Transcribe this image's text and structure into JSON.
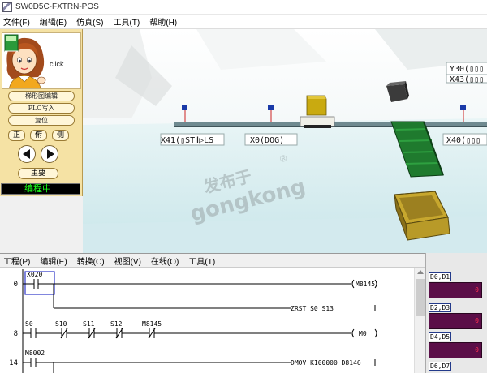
{
  "window": {
    "title": "SW0D5C-FXTRN-POS"
  },
  "menubar": [
    "文件(F)",
    "编辑(E)",
    "仿真(S)",
    "工具(T)",
    "帮助(H)"
  ],
  "sim_panel": {
    "click_label": "click",
    "buttons": {
      "ladder_edit": "梯形图编辑",
      "plc_write": "PLC写入",
      "reset": "复位",
      "main": "主要"
    },
    "view_buttons": [
      "正",
      "俯",
      "侧"
    ],
    "status": "编程中"
  },
  "scene": {
    "labels": {
      "y30": "Y30(▯▯▯",
      "x43": "X43(▯▯▯",
      "x41": "X41(▯STⅡ▷LS",
      "x0": "X0(DOG)",
      "x40": "X40(▯▯▯"
    },
    "watermark": {
      "line1": "发布于",
      "line2": "gongkong",
      "mark": "®"
    }
  },
  "editor": {
    "menu": [
      "工程(P)",
      "编辑(E)",
      "转换(C)",
      "视图(V)",
      "在线(O)",
      "工具(T)"
    ],
    "rungs": [
      {
        "step": "0",
        "contacts": [
          "X020"
        ],
        "coil": "M8145",
        "extra_coil": "ZRST   S0      S13"
      },
      {
        "step": "8",
        "contacts": [
          "S0",
          "S10",
          "S11",
          "S12",
          "M8145"
        ],
        "coil": "M0"
      },
      {
        "step": "14",
        "contacts": [
          "M8002"
        ],
        "instruction": "DMOV   K100000 D8146"
      }
    ]
  },
  "monitor": {
    "labels": [
      "D0,D1",
      "D2,D3",
      "D4,D5",
      "D6,D7"
    ],
    "values": [
      "0",
      "0",
      "0"
    ]
  }
}
